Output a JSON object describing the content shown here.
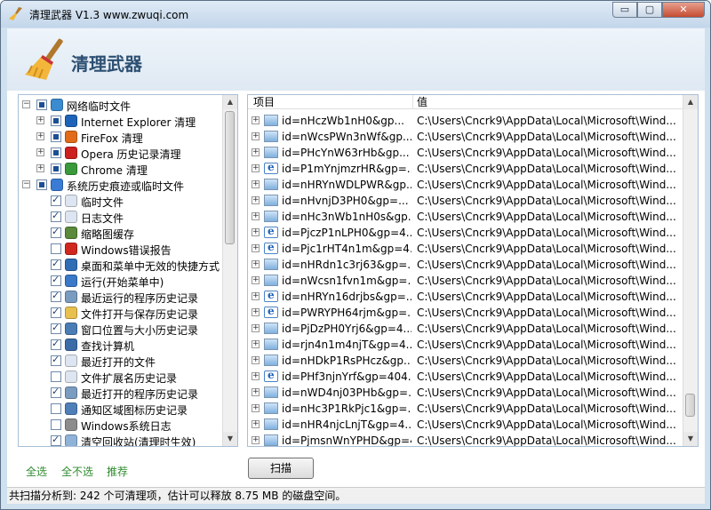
{
  "window": {
    "title": "清理武器 V1.3 www.zwuqi.com",
    "minimize_glyph": "▭",
    "maximize_glyph": "▢",
    "close_glyph": "✕"
  },
  "header": {
    "app_name": "清理武器"
  },
  "tree": {
    "items": [
      {
        "label": "网络临时文件",
        "icon": "globe-icon",
        "color": "#3a8bd0",
        "level": 0,
        "expander": "−",
        "check": "partial"
      },
      {
        "label": "Internet Explorer 清理",
        "icon": "ie-icon",
        "color": "#1e63b8",
        "level": 1,
        "expander": "+",
        "check": "partial"
      },
      {
        "label": "FireFox 清理",
        "icon": "firefox-icon",
        "color": "#e26b1a",
        "level": 1,
        "expander": "+",
        "check": "partial"
      },
      {
        "label": "Opera 历史记录清理",
        "icon": "opera-icon",
        "color": "#cc1f1f",
        "level": 1,
        "expander": "+",
        "check": "partial"
      },
      {
        "label": "Chrome 清理",
        "icon": "chrome-icon",
        "color": "#3a9a3a",
        "level": 1,
        "expander": "+",
        "check": "partial"
      },
      {
        "label": "系统历史痕迹或临时文件",
        "icon": "windows-icon",
        "color": "#3a7bd5",
        "level": 0,
        "expander": "−",
        "check": "partial"
      },
      {
        "label": "临时文件",
        "icon": "file-icon",
        "color": "#dde6f0",
        "level": 2,
        "check": "checked"
      },
      {
        "label": "日志文件",
        "icon": "file-icon",
        "color": "#dde6f0",
        "level": 2,
        "check": "checked"
      },
      {
        "label": "缩略图缓存",
        "icon": "settings-icon",
        "color": "#5a8a3a",
        "level": 2,
        "check": "checked"
      },
      {
        "label": "Windows错误报告",
        "icon": "error-icon",
        "color": "#d0281e",
        "level": 2,
        "check": "empty"
      },
      {
        "label": "桌面和菜单中无效的快捷方式",
        "icon": "desktop-icon",
        "color": "#2f6db5",
        "level": 2,
        "check": "checked"
      },
      {
        "label": "运行(开始菜单中)",
        "icon": "run-icon",
        "color": "#3a78c8",
        "level": 2,
        "check": "checked"
      },
      {
        "label": "最近运行的程序历史记录",
        "icon": "history-icon",
        "color": "#7a9cc0",
        "level": 2,
        "check": "checked"
      },
      {
        "label": "文件打开与保存历史记录",
        "icon": "folder-icon",
        "color": "#e8c050",
        "level": 2,
        "check": "checked"
      },
      {
        "label": "窗口位置与大小历史记录",
        "icon": "window-icon",
        "color": "#4a7db5",
        "level": 2,
        "check": "checked"
      },
      {
        "label": "查找计算机",
        "icon": "search-computer-icon",
        "color": "#3c6ca8",
        "level": 2,
        "check": "checked"
      },
      {
        "label": "最近打开的文件",
        "icon": "file-icon",
        "color": "#dde6f0",
        "level": 2,
        "check": "checked"
      },
      {
        "label": "文件扩展名历史记录",
        "icon": "file-icon",
        "color": "#dde6f0",
        "level": 2,
        "check": "empty"
      },
      {
        "label": "最近打开的程序历史记录",
        "icon": "history-icon",
        "color": "#7a9cc0",
        "level": 2,
        "check": "checked"
      },
      {
        "label": "通知区域图标历史记录",
        "icon": "tray-icon",
        "color": "#4f7fb8",
        "level": 2,
        "check": "empty"
      },
      {
        "label": "Windows系统日志",
        "icon": "log-icon",
        "color": "#8c8c8c",
        "level": 2,
        "check": "empty"
      },
      {
        "label": "清空回收站(清理时生效)",
        "icon": "recycle-bin-icon",
        "color": "#8fb3d8",
        "level": 2,
        "check": "checked"
      }
    ]
  },
  "list": {
    "col_item": "项目",
    "col_value": "值",
    "rows": [
      {
        "item": "id=nHczWb1nH0&gp...",
        "value": "C:\\Users\\Cncrk9\\AppData\\Local\\Microsoft\\Wind...",
        "icon": "img"
      },
      {
        "item": "id=nWcsPWn3nWf&gp...",
        "value": "C:\\Users\\Cncrk9\\AppData\\Local\\Microsoft\\Wind...",
        "icon": "img"
      },
      {
        "item": "id=PHcYnW63rHb&gp...",
        "value": "C:\\Users\\Cncrk9\\AppData\\Local\\Microsoft\\Wind...",
        "icon": "img"
      },
      {
        "item": "id=P1mYnjmzrHR&gp=...",
        "value": "C:\\Users\\Cncrk9\\AppData\\Local\\Microsoft\\Wind...",
        "icon": "ie"
      },
      {
        "item": "id=nHRYnWDLPWR&gp...",
        "value": "C:\\Users\\Cncrk9\\AppData\\Local\\Microsoft\\Wind...",
        "icon": "img"
      },
      {
        "item": "id=nHvnjD3PH0&gp=...",
        "value": "C:\\Users\\Cncrk9\\AppData\\Local\\Microsoft\\Wind...",
        "icon": "img"
      },
      {
        "item": "id=nHc3nWb1nH0s&gp...",
        "value": "C:\\Users\\Cncrk9\\AppData\\Local\\Microsoft\\Wind...",
        "icon": "img"
      },
      {
        "item": "id=PjczP1nLPH0&gp=4...",
        "value": "C:\\Users\\Cncrk9\\AppData\\Local\\Microsoft\\Wind...",
        "icon": "ie"
      },
      {
        "item": "id=Pjc1rHT4n1m&gp=4...",
        "value": "C:\\Users\\Cncrk9\\AppData\\Local\\Microsoft\\Wind...",
        "icon": "ie"
      },
      {
        "item": "id=nHRdn1c3rj63&gp=...",
        "value": "C:\\Users\\Cncrk9\\AppData\\Local\\Microsoft\\Wind...",
        "icon": "img"
      },
      {
        "item": "id=nWcsn1fvn1m&gp=...",
        "value": "C:\\Users\\Cncrk9\\AppData\\Local\\Microsoft\\Wind...",
        "icon": "img"
      },
      {
        "item": "id=nHRYn16drjbs&gp=...",
        "value": "C:\\Users\\Cncrk9\\AppData\\Local\\Microsoft\\Wind...",
        "icon": "ie"
      },
      {
        "item": "id=PWRYPH64rjm&gp=...",
        "value": "C:\\Users\\Cncrk9\\AppData\\Local\\Microsoft\\Wind...",
        "icon": "ie"
      },
      {
        "item": "id=PjDzPH0Yrj6&gp=4...",
        "value": "C:\\Users\\Cncrk9\\AppData\\Local\\Microsoft\\Wind...",
        "icon": "img"
      },
      {
        "item": "id=rjn4n1m4njT&gp=4...",
        "value": "C:\\Users\\Cncrk9\\AppData\\Local\\Microsoft\\Wind...",
        "icon": "img"
      },
      {
        "item": "id=nHDkP1RsPHcz&gp...",
        "value": "C:\\Users\\Cncrk9\\AppData\\Local\\Microsoft\\Wind...",
        "icon": "img"
      },
      {
        "item": "id=PHf3njnYrf&gp=404...",
        "value": "C:\\Users\\Cncrk9\\AppData\\Local\\Microsoft\\Wind...",
        "icon": "ie"
      },
      {
        "item": "id=nWD4nj03PHb&gp=...",
        "value": "C:\\Users\\Cncrk9\\AppData\\Local\\Microsoft\\Wind...",
        "icon": "img"
      },
      {
        "item": "id=nHc3P1RkPjc1&gp=...",
        "value": "C:\\Users\\Cncrk9\\AppData\\Local\\Microsoft\\Wind...",
        "icon": "img"
      },
      {
        "item": "id=nHR4njcLnjT&gp=4...",
        "value": "C:\\Users\\Cncrk9\\AppData\\Local\\Microsoft\\Wind...",
        "icon": "img"
      },
      {
        "item": "id=PjmsnWnYPHD&gp=4",
        "value": "C:\\Users\\Cncrk9\\AppData\\Local\\Microsoft\\Wind...",
        "icon": "img"
      }
    ]
  },
  "bottom": {
    "select_all": "全选",
    "select_none": "全不选",
    "recommend": "推荐",
    "scan_button": "扫描"
  },
  "status": {
    "text": "共扫描分析到: 242 个可清理项，估计可以释放 8.75 MB 的磁盘空间。"
  }
}
